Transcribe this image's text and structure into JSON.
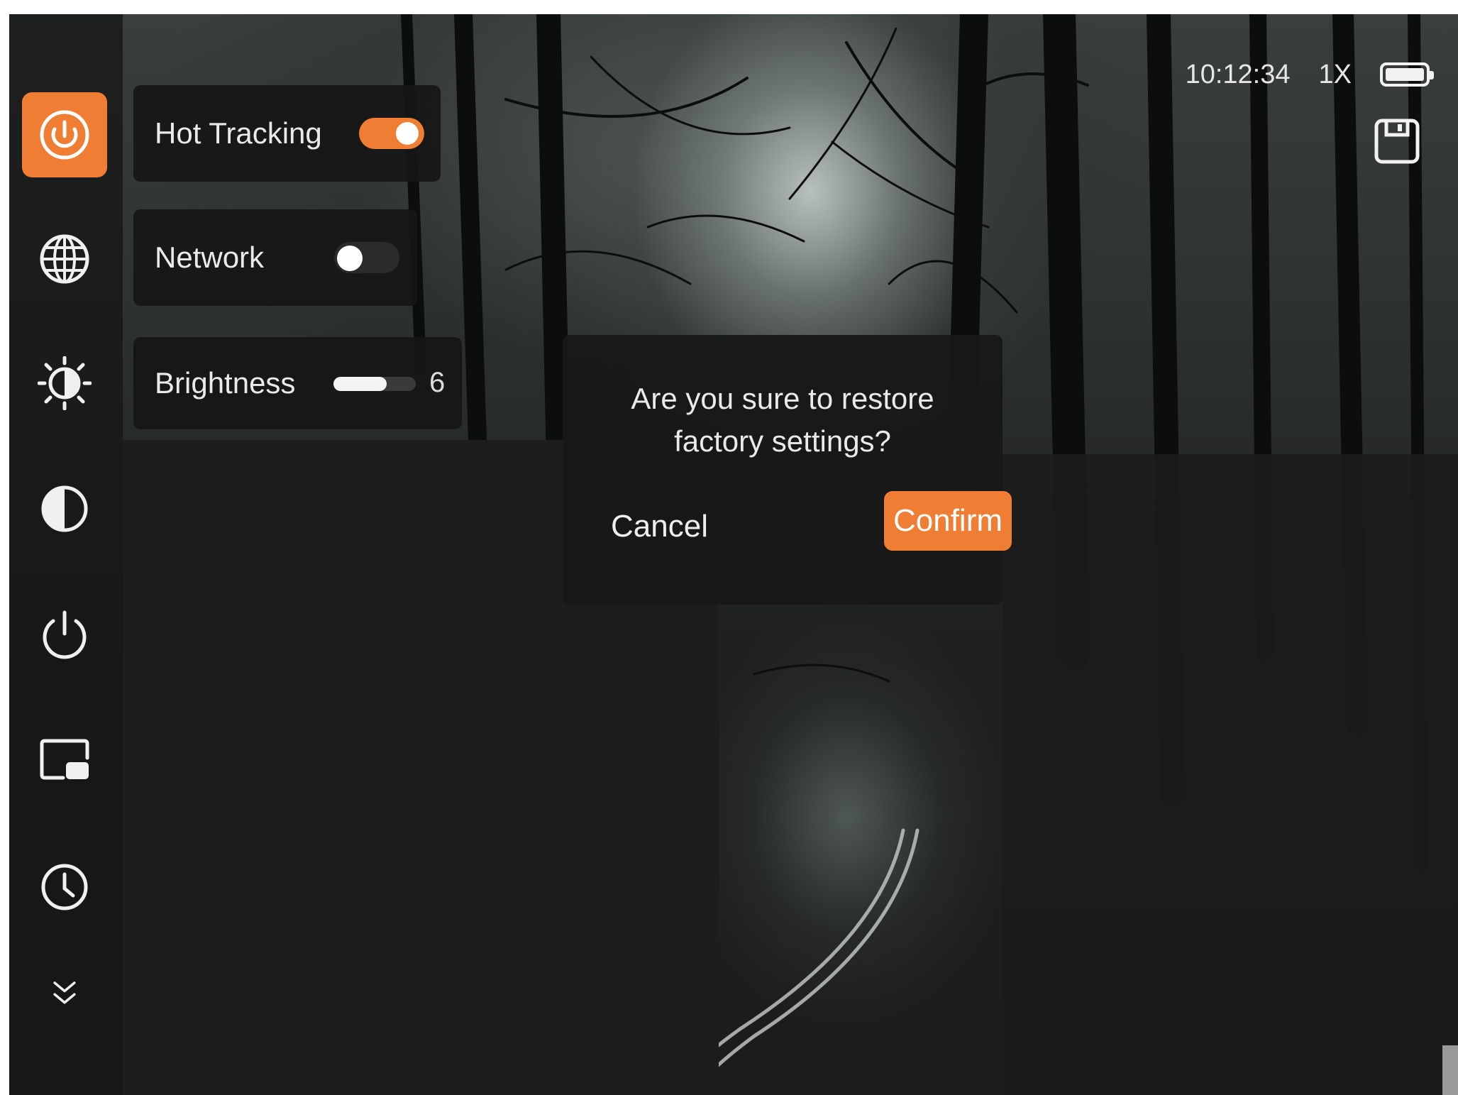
{
  "status_bar": {
    "time": "10:12:34",
    "zoom": "1X",
    "battery_level": 1.0,
    "battery_icon": "battery-icon",
    "save_icon": "save-icon"
  },
  "sidebar": {
    "items": [
      {
        "icon": "hot-tracking-icon",
        "active": true
      },
      {
        "icon": "globe-icon",
        "active": false
      },
      {
        "icon": "brightness-icon",
        "active": false
      },
      {
        "icon": "contrast-icon",
        "active": false
      },
      {
        "icon": "power-icon",
        "active": false
      },
      {
        "icon": "picture-in-picture-icon",
        "active": false
      },
      {
        "icon": "clock-icon",
        "active": false
      },
      {
        "icon": "chevron-double-down-icon",
        "active": false
      }
    ]
  },
  "settings": {
    "hot_tracking": {
      "label": "Hot Tracking",
      "enabled": true
    },
    "network": {
      "label": "Network",
      "enabled": false
    },
    "brightness": {
      "label": "Brightness",
      "value": "6",
      "level": 0.65
    }
  },
  "dialog": {
    "message": "Are you sure to restore\nfactory settings?",
    "cancel_label": "Cancel",
    "confirm_label": "Confirm"
  },
  "colors": {
    "accent": "#ef7d33",
    "panel": "#161616",
    "text": "#eaeaea"
  }
}
